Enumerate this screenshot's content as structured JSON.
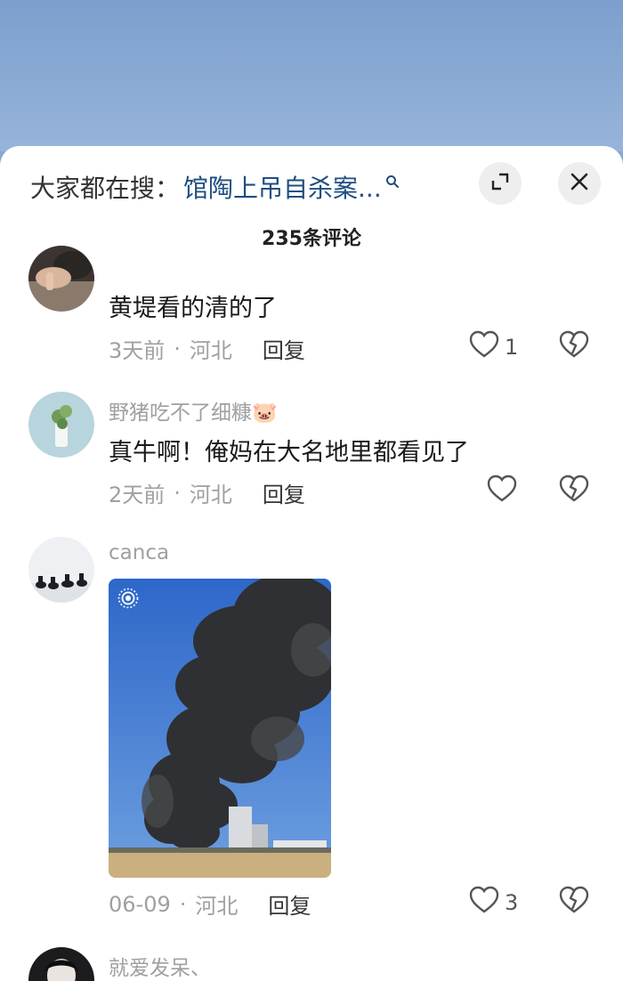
{
  "header": {
    "hot_search_prefix": "大家都在搜：",
    "hot_search_term": "馆陶上吊自杀案...",
    "comment_count": "235条评论"
  },
  "comments": [
    {
      "username": "",
      "text": "黄堤看的清的了",
      "time": "3天前",
      "location": "河北",
      "reply_label": "回复",
      "likes": "1"
    },
    {
      "username": "野猪吃不了细糠🐷",
      "text": "真牛啊！俺妈在大名地里都看见了",
      "time": "2天前",
      "location": "河北",
      "reply_label": "回复",
      "likes": ""
    },
    {
      "username": "canca",
      "text": "",
      "time": "06-09",
      "location": "河北",
      "reply_label": "回复",
      "likes": "3"
    },
    {
      "username": "就爱发呆、"
    }
  ],
  "icons": {
    "search": "search-icon",
    "expand": "expand-icon",
    "close": "close-icon",
    "like": "heart-icon",
    "dislike": "broken-heart-icon",
    "live_photo": "live-photo-icon"
  },
  "colors": {
    "hot_search_term": "#1f4e80",
    "meta_gray": "#a0a0a0",
    "sheet_bg": "#ffffff"
  }
}
